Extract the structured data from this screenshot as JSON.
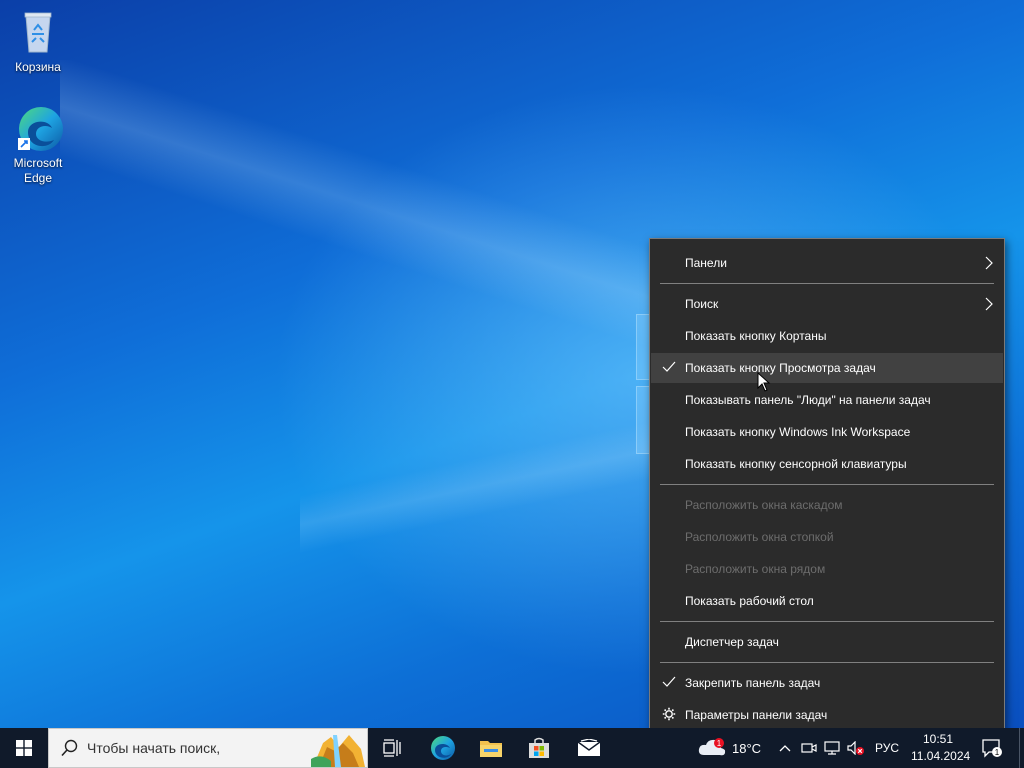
{
  "desktop": {
    "icons": [
      {
        "label": "Корзина",
        "icon": "recycle-bin-icon"
      },
      {
        "label": "Microsoft Edge",
        "icon": "edge-icon"
      }
    ]
  },
  "context_menu": {
    "items": [
      {
        "label": "Панели",
        "submenu": true
      },
      {
        "label": "Поиск",
        "submenu": true
      },
      {
        "label": "Показать кнопку Кортаны"
      },
      {
        "label": "Показать кнопку Просмотра задач",
        "checked": true
      },
      {
        "label": "Показывать панель \"Люди\" на панели задач"
      },
      {
        "label": "Показать кнопку Windows Ink Workspace"
      },
      {
        "label": "Показать кнопку сенсорной клавиатуры"
      },
      {
        "label": "Расположить окна каскадом",
        "disabled": true
      },
      {
        "label": "Расположить окна стопкой",
        "disabled": true
      },
      {
        "label": "Расположить окна рядом",
        "disabled": true
      },
      {
        "label": "Показать рабочий стол"
      },
      {
        "label": "Диспетчер задач"
      },
      {
        "label": "Закрепить панель задач",
        "checked": true
      },
      {
        "label": "Параметры панели задач",
        "icon": "gear-icon"
      }
    ]
  },
  "taskbar": {
    "search_placeholder": "Чтобы начать поиск,",
    "weather": "18°C",
    "language": "РУС",
    "time": "10:51",
    "date": "11.04.2024",
    "notifications_count": "1",
    "weather_badge": "1"
  },
  "colors": {
    "menu_bg": "#2b2b2b",
    "menu_hover": "#414141",
    "taskbar_bg": "#101a2a",
    "disabled_text": "#6d6d6d"
  }
}
